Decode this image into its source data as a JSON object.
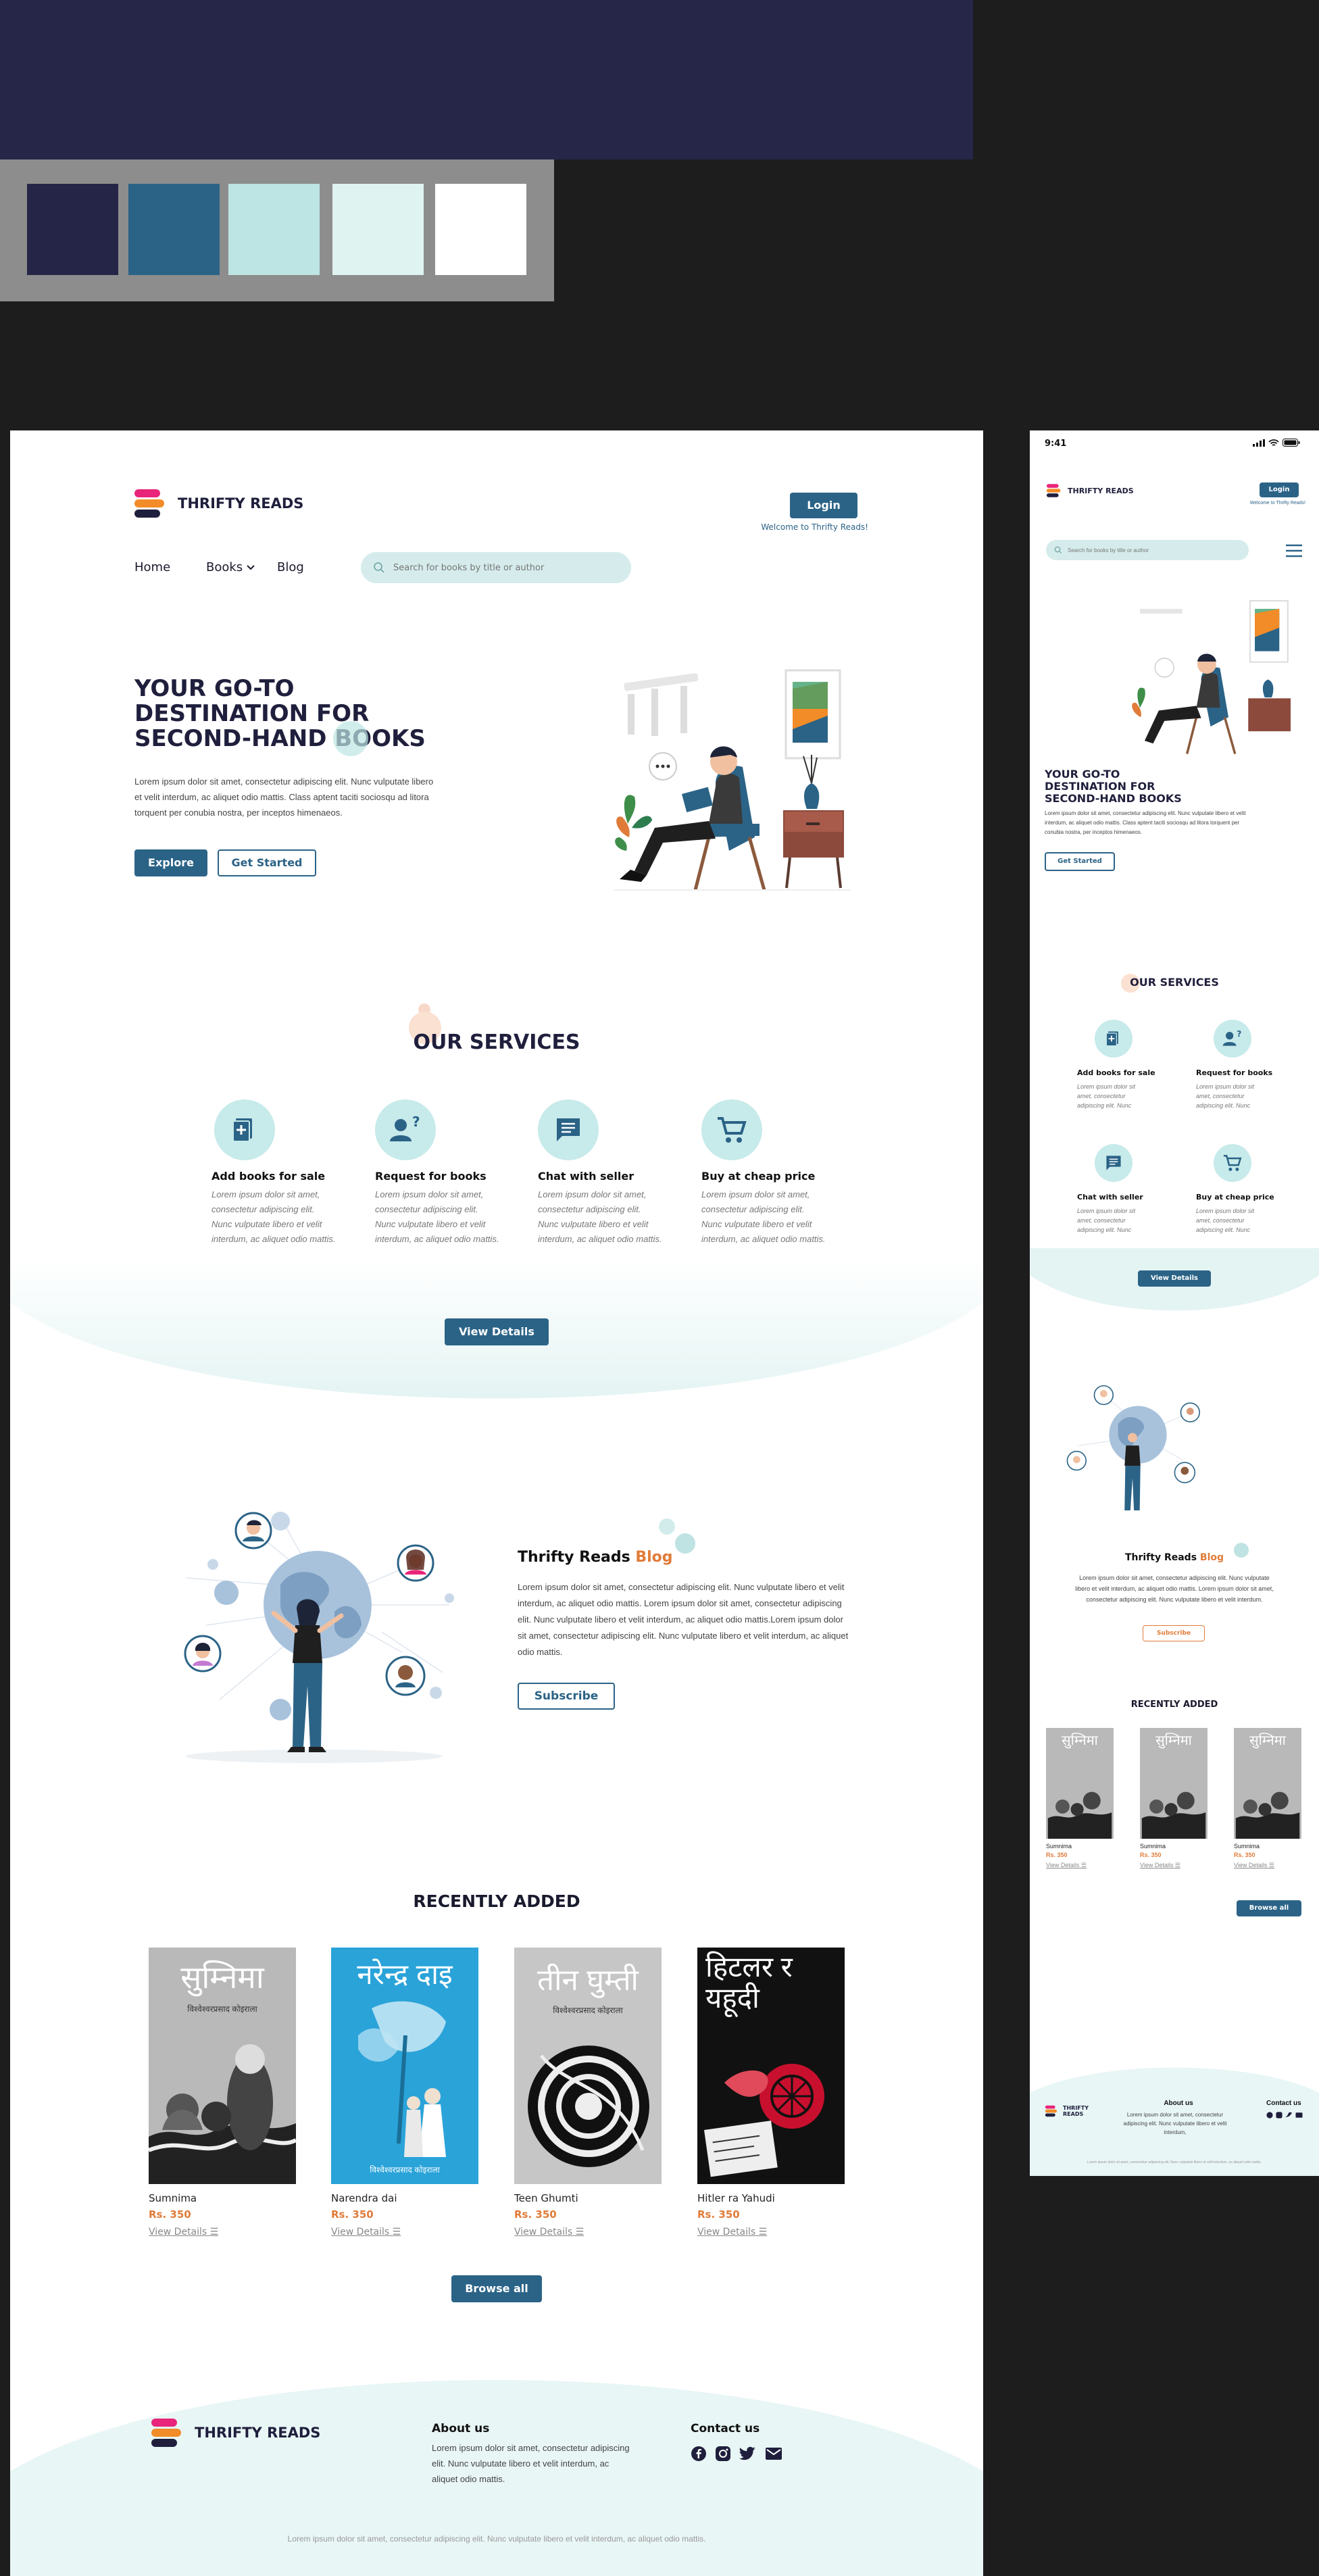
{
  "palette": {
    "swatches": [
      "#252548",
      "#2b6387",
      "#bde5e3",
      "#dff3f1",
      "#ffffff"
    ]
  },
  "colors": {
    "primary": "#2b6387",
    "navy": "#1f1f3d",
    "accent": "#e07b39",
    "mint": "#c7eaea"
  },
  "brand": {
    "name": "THRIFTY READS"
  },
  "header": {
    "login_label": "Login",
    "welcome_text": "Welcome to Thrifty Reads!",
    "nav": [
      {
        "label": "Home"
      },
      {
        "label": "Books"
      },
      {
        "label": "Blog"
      }
    ],
    "search_placeholder": "Search for books by title or author"
  },
  "hero": {
    "title_line1": "YOUR GO-TO",
    "title_line2": "DESTINATION FOR",
    "title_line3": "SECOND-HAND BOOKS",
    "body": "Lorem ipsum dolor sit amet, consectetur adipiscing elit. Nunc vulputate libero et velit interdum, ac aliquet odio mattis. Class aptent taciti sociosqu ad litora torquent per conubia nostra, per inceptos himenaeos.",
    "explore_label": "Explore",
    "get_started_label": "Get Started"
  },
  "services": {
    "title": "OUR SERVICES",
    "items": [
      {
        "title": "Add books for sale",
        "icon": "add-book-icon",
        "desc": "Lorem ipsum dolor sit amet, consectetur adipiscing elit. Nunc vulputate libero et velit interdum, ac aliquet odio mattis."
      },
      {
        "title": "Request for books",
        "icon": "user-question-icon",
        "desc": "Lorem ipsum dolor sit amet, consectetur adipiscing elit. Nunc vulputate libero et velit interdum, ac aliquet odio mattis."
      },
      {
        "title": "Chat with seller",
        "icon": "chat-icon",
        "desc": "Lorem ipsum dolor sit amet, consectetur adipiscing elit. Nunc vulputate libero et velit interdum, ac aliquet odio mattis."
      },
      {
        "title": "Buy at cheap price",
        "icon": "cart-icon",
        "desc": "Lorem ipsum dolor sit amet, consectetur adipiscing elit. Nunc vulputate libero et velit interdum, ac aliquet odio mattis."
      }
    ],
    "view_details_label": "View Details"
  },
  "blog": {
    "title_part1": "Thrifty Reads",
    "title_part2": "Blog",
    "body": "Lorem ipsum dolor sit amet, consectetur adipiscing elit. Nunc vulputate libero et velit interdum, ac aliquet odio mattis. Lorem ipsum dolor sit amet, consectetur adipiscing elit. Nunc vulputate libero et velit interdum, ac aliquet odio mattis.Lorem ipsum dolor sit amet, consectetur adipiscing elit. Nunc vulputate libero et velit interdum, ac aliquet odio mattis.",
    "subscribe_label": "Subscribe"
  },
  "recent": {
    "title": "RECENTLY ADDED",
    "books": [
      {
        "name": "Sumnima",
        "price": "Rs. 350",
        "view": "View Details",
        "cover_title": "सुम्निमा",
        "cover_author": "विश्वेश्वरप्रसाद कोइराला",
        "cover_bg": "#b9b9b9"
      },
      {
        "name": "Narendra dai",
        "price": "Rs. 350",
        "view": "View Details",
        "cover_title": "नरेन्द्र दाइ",
        "cover_author": "विश्वेश्वरप्रसाद कोइराला",
        "cover_bg": "#2aa3d9"
      },
      {
        "name": "Teen Ghumti",
        "price": "Rs. 350",
        "view": "View Details",
        "cover_title": "तीन घुम्ती",
        "cover_author": "विश्वेश्वरप्रसाद कोइराला",
        "cover_bg": "#c6c6c6"
      },
      {
        "name": "Hitler ra Yahudi",
        "price": "Rs. 350",
        "view": "View Details",
        "cover_title": "हिटलर र यहूदी",
        "cover_author": "",
        "cover_bg": "#111111"
      }
    ],
    "browse_label": "Browse all"
  },
  "footer": {
    "about_title": "About us",
    "about_body": "Lorem ipsum dolor sit amet, consectetur adipiscing elit. Nunc vulputate libero et velit interdum, ac aliquet odio mattis.",
    "contact_title": "Contact us",
    "social_icons": [
      "facebook-icon",
      "instagram-icon",
      "twitter-icon",
      "mail-icon"
    ],
    "copyright": "Lorem ipsum dolor sit amet, consectetur adipiscing elit. Nunc vulputate libero et velit interdum, ac aliquet odio mattis."
  },
  "mobile": {
    "time": "9:41",
    "about_body": "Lorem ipsum dolor sit amet, consectetur adipiscing elit. Nunc vulputate libero et velit interdum,",
    "blog_body": "Lorem ipsum dolor sit amet, consectetur adipiscing elit. Nunc vulputate libero et velit interdum, ac aliquet odio mattis. Lorem ipsum dolor sit amet, consectetur adipiscing elit. Nunc vulputate libero et velit interdum.",
    "service_desc": "Lorem ipsum dolor sit amet, consectetur adipiscing elit. Nunc",
    "browse_label": "Browse all"
  }
}
